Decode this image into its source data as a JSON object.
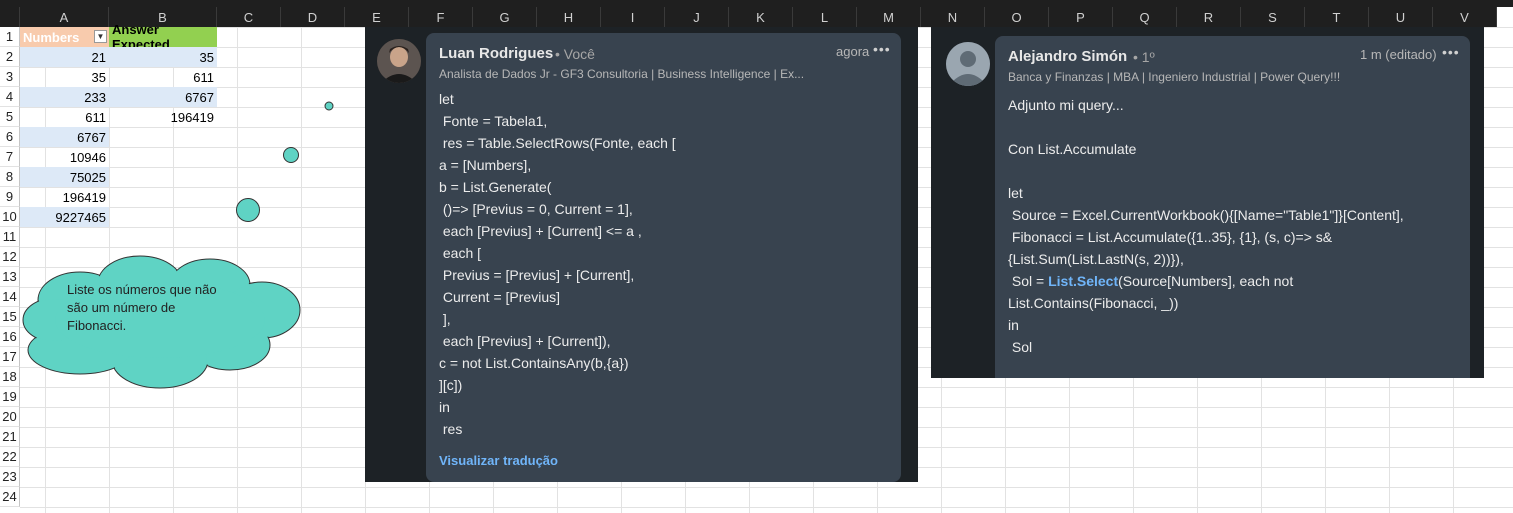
{
  "columns": [
    "A",
    "B",
    "C",
    "D",
    "E",
    "F",
    "G",
    "H",
    "I",
    "J",
    "K",
    "L",
    "M",
    "N",
    "O",
    "P",
    "Q",
    "R",
    "S",
    "T",
    "U",
    "V"
  ],
  "rows": [
    "1",
    "2",
    "3",
    "4",
    "5",
    "6",
    "7",
    "8",
    "9",
    "10",
    "11",
    "12",
    "13",
    "14",
    "15",
    "16",
    "17",
    "18",
    "19",
    "20",
    "21",
    "22",
    "23",
    "24"
  ],
  "table": {
    "header_a": "Numbers",
    "header_b": "Answer Expected",
    "numbers": [
      "21",
      "35",
      "233",
      "611",
      "6767",
      "10946",
      "75025",
      "196419",
      "9227465"
    ],
    "expected": [
      "35",
      "611",
      "6767",
      "196419"
    ]
  },
  "callout": {
    "lines": [
      "Liste os números que não",
      "são um número de",
      "Fibonacci."
    ]
  },
  "post1": {
    "name": "Luan Rodrigues",
    "degree": "• Você",
    "headline": "Analista de Dados Jr - GF3 Consultoria | Business Intelligence | Ex...",
    "time": "agora",
    "more": "•••",
    "code": [
      "let",
      " Fonte = Tabela1,",
      " res = Table.SelectRows(Fonte, each [",
      "a = [Numbers],",
      "b = List.Generate(",
      " ()=> [Previus = 0, Current = 1],",
      " each [Previus] + [Current] <= a ,",
      " each [",
      " Previus = [Previus] + [Current],",
      " Current = [Previus]",
      " ],",
      " each [Previus] + [Current]),",
      "c = not List.ContainsAny(b,{a})",
      "][c])",
      "in",
      " res"
    ],
    "translate": "Visualizar tradução"
  },
  "post2": {
    "name": "Alejandro Simón",
    "degree": "• 1º",
    "headline": "Banca y Finanzas | MBA | Ingeniero Industrial | Power Query!!!",
    "time": "1 m (editado)",
    "more": "•••",
    "intro": "Adjunto mi query...",
    "intro2": "Con List.Accumulate",
    "code": [
      "let",
      " Source = Excel.CurrentWorkbook(){[Name=\"Table1\"]}[Content],",
      " Fibonacci = List.Accumulate({1..35}, {1}, (s, c)=> s&",
      "{List.Sum(List.LastN(s, 2))}),"
    ],
    "sol_prefix": " Sol = ",
    "sol_link": "List.Select",
    "sol_suffix": "(Source[Numbers], each not",
    "code_tail": [
      "List.Contains(Fibonacci, _))",
      "in",
      " Sol"
    ]
  },
  "colors": {
    "teal": "#5fd3c4",
    "link": "#70b5f9",
    "header_orange": "#f8cbad",
    "header_green": "#92d050"
  }
}
